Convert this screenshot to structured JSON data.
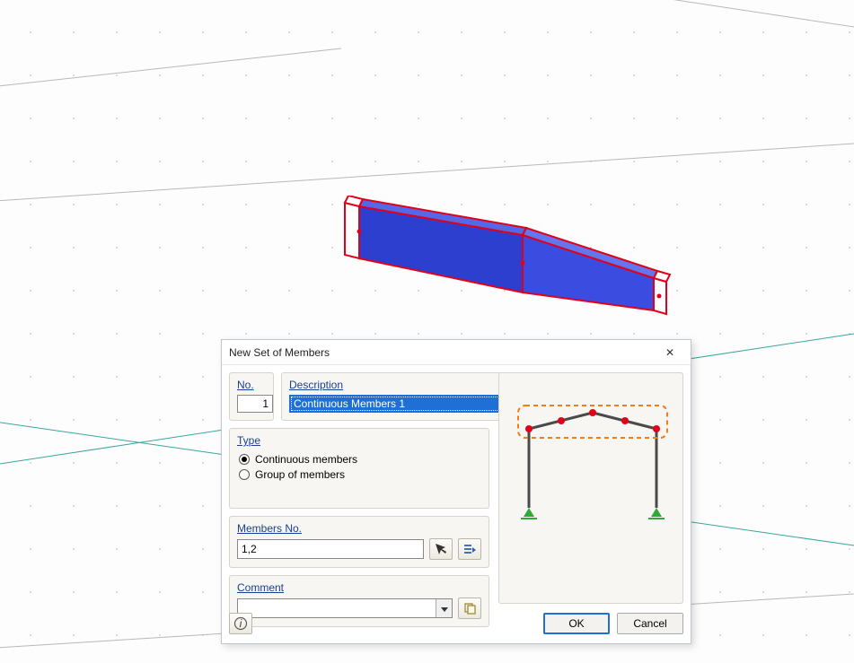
{
  "dialog": {
    "title": "New Set of Members",
    "no": {
      "label": "No.",
      "value": "1"
    },
    "description": {
      "label": "Description",
      "value": "Continuous Members 1"
    },
    "type": {
      "label": "Type",
      "options": {
        "continuous": "Continuous members",
        "group": "Group of members"
      },
      "selected": "continuous"
    },
    "members": {
      "label": "Members No.",
      "value": "1,2"
    },
    "comment": {
      "label": "Comment",
      "value": ""
    },
    "buttons": {
      "ok": "OK",
      "cancel": "Cancel"
    }
  },
  "icons": {
    "close": "✕",
    "pick": "pick-icon",
    "select": "select-icon",
    "copy": "copy-icon",
    "help": "help-icon"
  }
}
